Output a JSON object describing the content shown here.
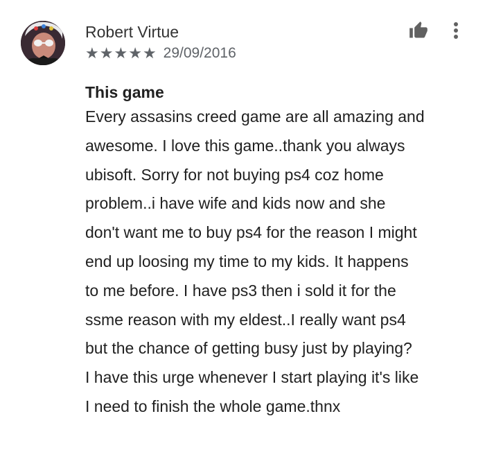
{
  "review": {
    "author": "Robert Virtue",
    "rating": 5,
    "rating_max": 5,
    "stars": [
      "★",
      "★",
      "★",
      "★",
      "★"
    ],
    "date": "29/09/2016",
    "title": "This game",
    "body_lines": [
      "Every assasins creed game are all amazing and",
      "awesome. I love this game..thank you always",
      "ubisoft. Sorry for not buying ps4 coz home",
      "problem..i have wife and kids now and she",
      "don't want me to buy ps4 for the reason I might",
      "end up loosing my time to my kids. It happens",
      "to me before. I have ps3 then i sold it for the",
      "ssme reason with my eldest..I really want ps4",
      "but the chance of getting busy just by playing?",
      "I have this urge whenever I start playing it's like",
      "I need to finish the whole game.thnx"
    ]
  },
  "icons": {
    "thumbs_up": "thumbs-up-icon",
    "more": "more-vertical-icon"
  },
  "colors": {
    "text_primary": "#212121",
    "text_secondary": "#5f6368",
    "background": "#ffffff"
  }
}
